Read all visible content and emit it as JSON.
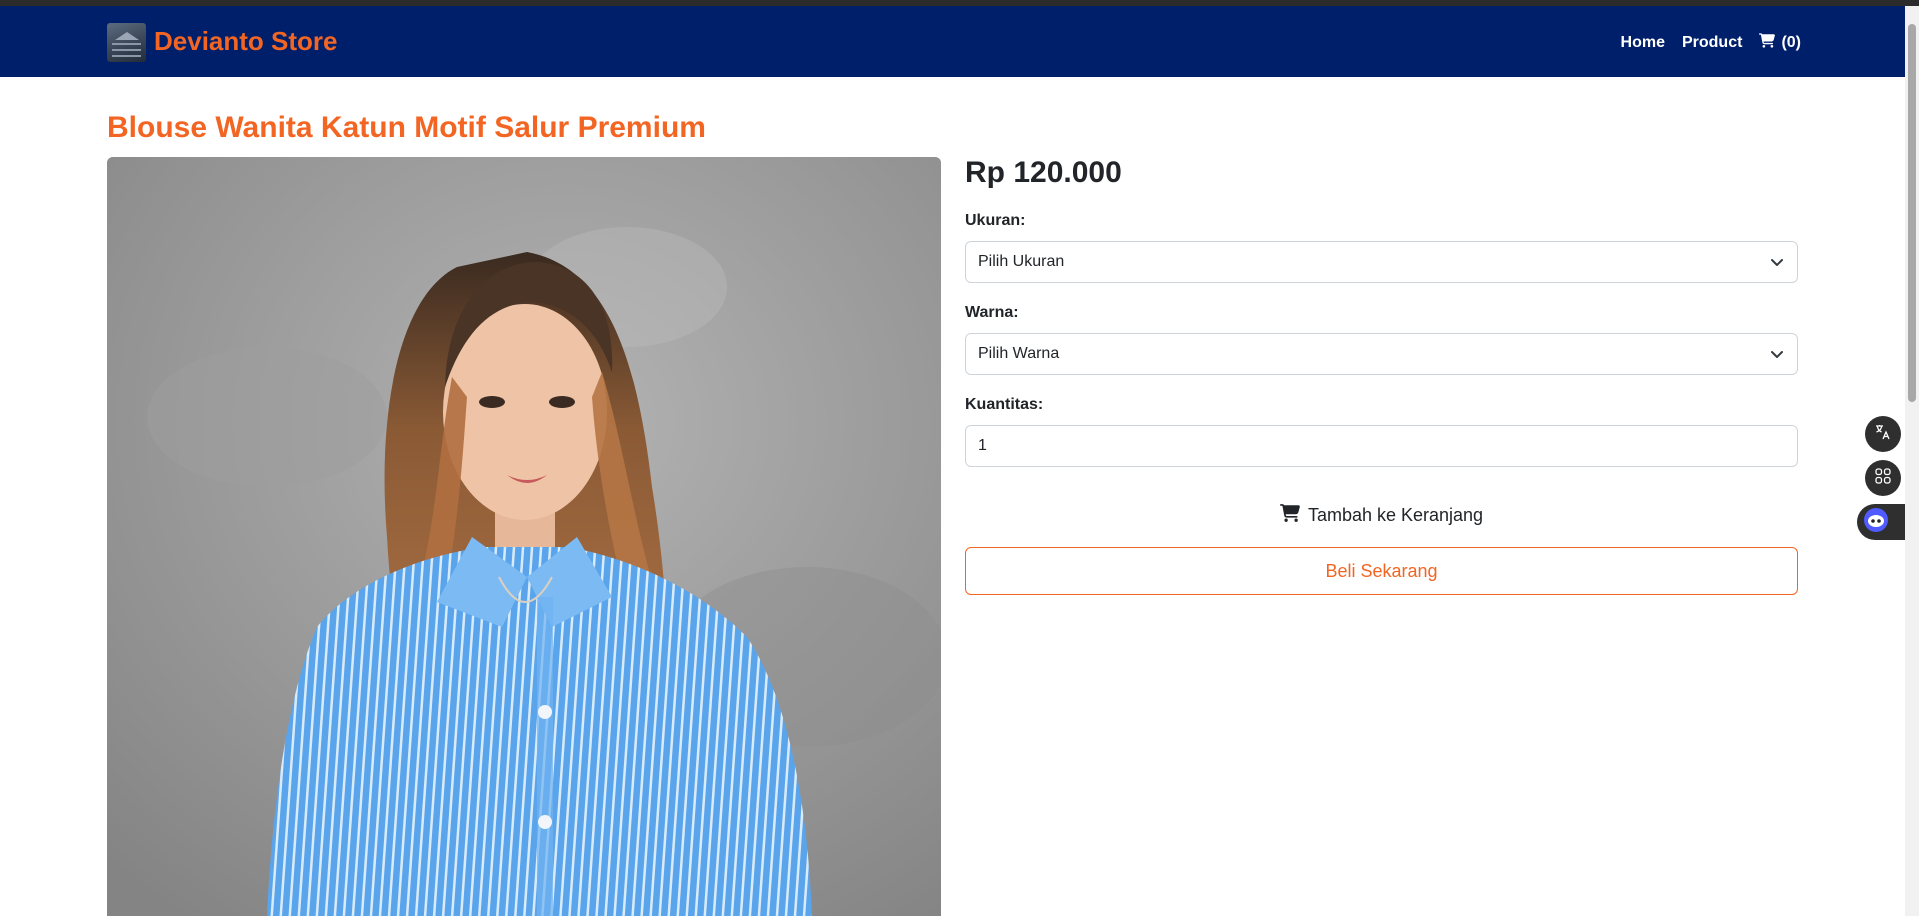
{
  "colors": {
    "navbar": "#001f6b",
    "accent": "#f26522",
    "text": "#212529",
    "border": "#ced4da"
  },
  "navbar": {
    "brand_name": "Devianto Store",
    "brand_logo_icon": "clothes-hanger-logo",
    "links": [
      {
        "label": "Home"
      },
      {
        "label": "Product"
      }
    ],
    "cart_icon": "cart-icon",
    "cart_count": "(0)"
  },
  "product": {
    "title": "Blouse Wanita Katun Motif Salur Premium",
    "image_icon": "product-photo",
    "price": "Rp 120.000",
    "size_label": "Ukuran:",
    "size_select_value": "Pilih Ukuran",
    "color_label": "Warna:",
    "color_select_value": "Pilih Warna",
    "quantity_label": "Kuantitas:",
    "quantity_value": "1",
    "add_to_cart_label": "Tambah ke Keranjang",
    "buy_now_label": "Beli Sekarang"
  },
  "side_widgets": [
    {
      "icon": "translate-icon"
    },
    {
      "icon": "apps-grid-icon"
    },
    {
      "icon": "assistant-bot-icon"
    }
  ]
}
